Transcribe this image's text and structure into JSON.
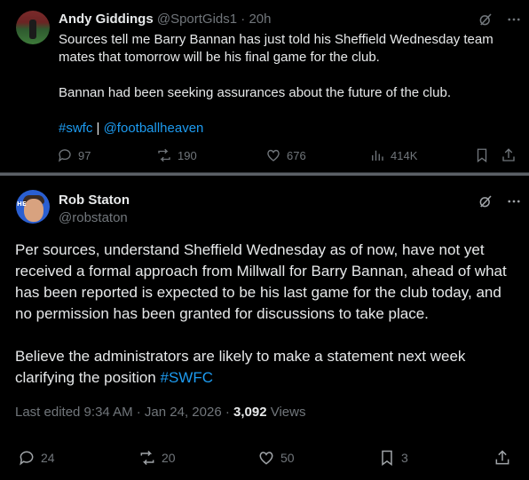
{
  "tweet1": {
    "author_name": "Andy Giddings",
    "handle": "@SportGids1",
    "separator": "·",
    "time": "20h",
    "body_line1": "Sources tell me Barry Bannan has just told his Sheffield Wednesday team mates that tomorrow will be his final game for the club.",
    "body_line2": "Bannan had been seeking assurances about the future of the club.",
    "hashtag": "#swfc",
    "pipe": " | ",
    "mention": "@footballheaven",
    "replies": "97",
    "reposts": "190",
    "likes": "676",
    "views": "414K"
  },
  "tweet2": {
    "author_name": "Rob Staton",
    "handle": "@robstaton",
    "body_para1": "Per sources, understand Sheffield Wednesday as of now, have not yet received a formal approach from Millwall for Barry Bannan, ahead of what has been reported is expected to be his last game for the club today, and no permission has been granted for discussions to take place.",
    "body_para2_text": "Believe the administrators are likely to make a statement next week clarifying the position ",
    "body_para2_hashtag": "#SWFC",
    "edited_prefix": "Last edited 9:34 AM · Jan 24, 2026 · ",
    "views_count": "3,092",
    "views_label": " Views",
    "replies": "24",
    "reposts": "20",
    "likes": "50",
    "bookmarks": "3"
  },
  "icons": [
    "grok-icon",
    "more-icon",
    "reply-icon",
    "repost-icon",
    "like-icon",
    "views-icon",
    "bookmark-icon",
    "share-icon"
  ],
  "colors": {
    "background": "#000000",
    "text": "#e7e9ea",
    "muted": "#71767b",
    "link": "#1d9bf0",
    "divider": "#2f3336"
  }
}
